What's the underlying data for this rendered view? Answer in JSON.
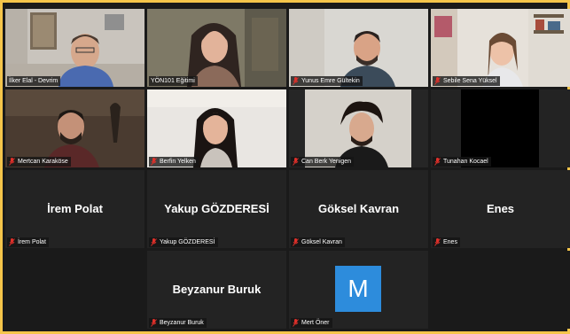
{
  "participants": [
    {
      "label": "İlker Elal - Devrim",
      "view": "video"
    },
    {
      "label": "YÖN101 Eğitimi",
      "view": "video",
      "active": true
    },
    {
      "label": "Yunus Emre Gültekin",
      "view": "video"
    },
    {
      "label": "Sebile Sena Yüksel",
      "view": "video"
    },
    {
      "label": "Mertcan Karaköse",
      "view": "video"
    },
    {
      "label": "Berfin Yelken",
      "view": "video"
    },
    {
      "label": "Can Berk Yenigen",
      "view": "video"
    },
    {
      "label": "Tunahan Kocael",
      "view": "video"
    },
    {
      "label": "İrem Polat",
      "display_name": "İrem Polat",
      "view": "name"
    },
    {
      "label": "Yakup GÖZDERESİ",
      "display_name": "Yakup GÖZDERESİ",
      "view": "name"
    },
    {
      "label": "Göksel Kavran",
      "display_name": "Göksel Kavran",
      "view": "name"
    },
    {
      "label": "Enes",
      "display_name": "Enes",
      "view": "name"
    },
    {
      "label": "Beyzanur Buruk",
      "display_name": "Beyzanur Buruk",
      "view": "name"
    },
    {
      "label": "Mert Öner",
      "avatar_letter": "M",
      "view": "avatar"
    }
  ],
  "colors": {
    "frame": "#f5c54a",
    "active_border": "#e8e45a",
    "muted_icon": "#e0302a",
    "avatar_bg": "#2d8cdc"
  },
  "icons": {
    "muted": "muted-mic-icon"
  }
}
